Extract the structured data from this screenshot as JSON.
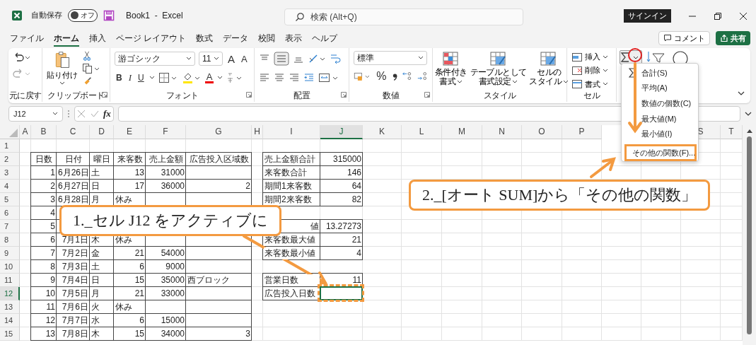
{
  "title_bar": {
    "autosave_label": "自動保存",
    "autosave": {
      "label": "オフ",
      "on": false
    },
    "title": "Book1  -  Excel",
    "search_placeholder": "検索 (Alt+Q)",
    "signin": "サインイン"
  },
  "tabs": [
    {
      "label": "ファイル",
      "selected": false
    },
    {
      "label": "ホーム",
      "selected": true
    },
    {
      "label": "挿入",
      "selected": false
    },
    {
      "label": "ページ レイアウト",
      "selected": false
    },
    {
      "label": "数式",
      "selected": false
    },
    {
      "label": "データ",
      "selected": false
    },
    {
      "label": "校閲",
      "selected": false
    },
    {
      "label": "表示",
      "selected": false
    },
    {
      "label": "ヘルプ",
      "selected": false
    }
  ],
  "comment_button": "コメント",
  "share_button": "共有",
  "ribbon": {
    "undo_group": {
      "label": "元に戻す"
    },
    "clipboard_group": {
      "label": "クリップボード",
      "paste": "貼り付け"
    },
    "font_group": {
      "label": "フォント",
      "font": "游ゴシック",
      "size": "11",
      "grow": "A",
      "shrink": "A",
      "bold": "B",
      "italic": "I",
      "underline": "U",
      "font_color": "A"
    },
    "alignment_group": {
      "label": "配置"
    },
    "number_group": {
      "label": "数値",
      "format": "標準",
      "percent": "%"
    },
    "styles_group": {
      "label": "スタイル",
      "buttons": [
        [
          "条件付き",
          "書式"
        ],
        [
          "テーブルとして",
          "書式設定"
        ],
        [
          "セルの",
          "スタイル"
        ]
      ]
    },
    "cells_group": {
      "label": "セル",
      "buttons": [
        "挿入",
        "削除",
        "書式"
      ]
    }
  },
  "autosum_menu": [
    {
      "label": "合計(S)",
      "kind": "sum",
      "selected": false
    },
    {
      "label": "平均(A)",
      "kind": "plain",
      "selected": false
    },
    {
      "label": "数値の個数(C)",
      "kind": "plain",
      "selected": false
    },
    {
      "label": "最大値(M)",
      "kind": "plain",
      "selected": false
    },
    {
      "label": "最小値(I)",
      "kind": "plain",
      "selected": false
    },
    {
      "label": "その他の関数(F)...",
      "kind": "plain",
      "selected": true
    }
  ],
  "formula_bar": {
    "name_box": "J12",
    "fx": "fx"
  },
  "columns": [
    {
      "label": "A",
      "selected": false
    },
    {
      "label": "B",
      "selected": false
    },
    {
      "label": "C",
      "selected": false
    },
    {
      "label": "D",
      "selected": false
    },
    {
      "label": "E",
      "selected": false
    },
    {
      "label": "F",
      "selected": false
    },
    {
      "label": "G",
      "selected": false
    },
    {
      "label": "H",
      "selected": false
    },
    {
      "label": "I",
      "selected": false
    },
    {
      "label": "J",
      "selected": true
    },
    {
      "label": "K",
      "selected": false
    },
    {
      "label": "L",
      "selected": false
    },
    {
      "label": "M",
      "selected": false
    },
    {
      "label": "N",
      "selected": false
    },
    {
      "label": "O",
      "selected": false
    },
    {
      "label": "P",
      "selected": false
    },
    {
      "kind": "covered"
    },
    {
      "kind": "covered"
    },
    {
      "label": "S",
      "selected": false
    },
    {
      "label": "T",
      "selected": false
    }
  ],
  "rows": [
    {
      "header": "1",
      "selected": false
    },
    {
      "header": "2",
      "selected": false,
      "left": [
        {
          "kind": "head",
          "text": "日数"
        },
        {
          "kind": "head",
          "text": "日付"
        },
        {
          "kind": "head",
          "text": "曜日"
        },
        {
          "kind": "head",
          "text": "来客数"
        },
        {
          "kind": "head",
          "text": "売上金額"
        },
        {
          "kind": "head",
          "text": "広告投入区域数"
        }
      ],
      "right": [
        {
          "kind": "text",
          "text": "売上金額合計"
        },
        {
          "kind": "num",
          "text": "315000"
        }
      ]
    },
    {
      "header": "3",
      "selected": false,
      "left": [
        {
          "kind": "num",
          "text": "1"
        },
        {
          "kind": "num",
          "text": "6月26日"
        },
        {
          "kind": "text",
          "text": "土"
        },
        {
          "kind": "num",
          "text": "13"
        },
        {
          "kind": "num",
          "text": "31000"
        },
        {
          "kind": "blank"
        }
      ],
      "right": [
        {
          "kind": "text",
          "text": "来客数合計"
        },
        {
          "kind": "num",
          "text": "146"
        }
      ]
    },
    {
      "header": "4",
      "selected": false,
      "left": [
        {
          "kind": "num",
          "text": "2"
        },
        {
          "kind": "num",
          "text": "6月27日"
        },
        {
          "kind": "text",
          "text": "日"
        },
        {
          "kind": "num",
          "text": "17"
        },
        {
          "kind": "num",
          "text": "36000"
        },
        {
          "kind": "num",
          "text": "2"
        }
      ],
      "right": [
        {
          "kind": "text",
          "text": "期間1来客数"
        },
        {
          "kind": "num",
          "text": "64"
        }
      ]
    },
    {
      "header": "5",
      "selected": false,
      "left": [
        {
          "kind": "num",
          "text": "3"
        },
        {
          "kind": "num",
          "text": "6月28日"
        },
        {
          "kind": "text",
          "text": "月"
        },
        {
          "kind": "text",
          "text": "休み"
        },
        {
          "kind": "blank"
        },
        {
          "kind": "blank"
        }
      ],
      "right": [
        {
          "kind": "text",
          "text": "期間2来客数"
        },
        {
          "kind": "num",
          "text": "82"
        }
      ]
    },
    {
      "header": "6",
      "selected": false,
      "left": [
        {
          "kind": "num",
          "text": "4"
        },
        {
          "kind": "blank"
        },
        {
          "kind": "blank"
        },
        {
          "kind": "blank"
        },
        {
          "kind": "blank"
        },
        {
          "kind": "blank"
        }
      ]
    },
    {
      "header": "7",
      "selected": false,
      "left": [
        {
          "kind": "num",
          "text": "5"
        },
        {
          "kind": "blank"
        },
        {
          "kind": "blank"
        },
        {
          "kind": "blank"
        },
        {
          "kind": "blank"
        },
        {
          "kind": "blank"
        }
      ],
      "right": [
        {
          "kind": "tail",
          "text": "値"
        },
        {
          "kind": "num",
          "text": "13.27273"
        }
      ]
    },
    {
      "header": "8",
      "selected": false,
      "left": [
        {
          "kind": "num",
          "text": "6"
        },
        {
          "kind": "num",
          "text": "7月1日"
        },
        {
          "kind": "text",
          "text": "木"
        },
        {
          "kind": "text",
          "text": "休み"
        },
        {
          "kind": "blank"
        },
        {
          "kind": "blank"
        }
      ],
      "right": [
        {
          "kind": "text",
          "text": "来客数最大値"
        },
        {
          "kind": "num",
          "text": "21"
        }
      ]
    },
    {
      "header": "9",
      "selected": false,
      "left": [
        {
          "kind": "num",
          "text": "7"
        },
        {
          "kind": "num",
          "text": "7月2日"
        },
        {
          "kind": "text",
          "text": "金"
        },
        {
          "kind": "num",
          "text": "21"
        },
        {
          "kind": "num",
          "text": "54000"
        },
        {
          "kind": "blank"
        }
      ],
      "right": [
        {
          "kind": "text",
          "text": "来客数最小値"
        },
        {
          "kind": "num",
          "text": "4"
        }
      ]
    },
    {
      "header": "10",
      "selected": false,
      "left": [
        {
          "kind": "num",
          "text": "8"
        },
        {
          "kind": "num",
          "text": "7月3日"
        },
        {
          "kind": "text",
          "text": "土"
        },
        {
          "kind": "num",
          "text": "6"
        },
        {
          "kind": "num",
          "text": "9000"
        },
        {
          "kind": "blank"
        }
      ]
    },
    {
      "header": "11",
      "selected": false,
      "left": [
        {
          "kind": "num",
          "text": "9"
        },
        {
          "kind": "num",
          "text": "7月4日"
        },
        {
          "kind": "text",
          "text": "日"
        },
        {
          "kind": "num",
          "text": "15"
        },
        {
          "kind": "num",
          "text": "35000"
        },
        {
          "kind": "text",
          "text": "西ブロック"
        }
      ],
      "right": [
        {
          "kind": "text",
          "text": "営業日数"
        },
        {
          "kind": "num",
          "text": "11"
        }
      ]
    },
    {
      "header": "12",
      "selected": true,
      "left": [
        {
          "kind": "num",
          "text": "10"
        },
        {
          "kind": "num",
          "text": "7月5日"
        },
        {
          "kind": "text",
          "text": "月"
        },
        {
          "kind": "num",
          "text": "21"
        },
        {
          "kind": "num",
          "text": "33000"
        },
        {
          "kind": "blank"
        }
      ],
      "right": [
        {
          "kind": "text",
          "text": "広告投入日数"
        },
        {
          "kind": "active"
        }
      ]
    },
    {
      "header": "13",
      "selected": false,
      "left": [
        {
          "kind": "num",
          "text": "11"
        },
        {
          "kind": "num",
          "text": "7月6日"
        },
        {
          "kind": "text",
          "text": "火"
        },
        {
          "kind": "text",
          "text": "休み"
        },
        {
          "kind": "blank"
        },
        {
          "kind": "blank"
        }
      ]
    },
    {
      "header": "14",
      "selected": false,
      "left": [
        {
          "kind": "num",
          "text": "12"
        },
        {
          "kind": "num",
          "text": "7月7日"
        },
        {
          "kind": "text",
          "text": "水"
        },
        {
          "kind": "num",
          "text": "6"
        },
        {
          "kind": "num",
          "text": "15000"
        },
        {
          "kind": "blank"
        }
      ]
    },
    {
      "header": "15",
      "selected": false,
      "left": [
        {
          "kind": "num",
          "text": "13"
        },
        {
          "kind": "num",
          "text": "7月8日"
        },
        {
          "kind": "text",
          "text": "木"
        },
        {
          "kind": "num",
          "text": "15"
        },
        {
          "kind": "num",
          "text": "34000"
        },
        {
          "kind": "num",
          "text": "3"
        }
      ]
    }
  ],
  "callouts": [
    {
      "text": "1._セル J12 をアクティブに"
    },
    {
      "text": "2._[オート SUM]から「その他の関数」"
    }
  ]
}
